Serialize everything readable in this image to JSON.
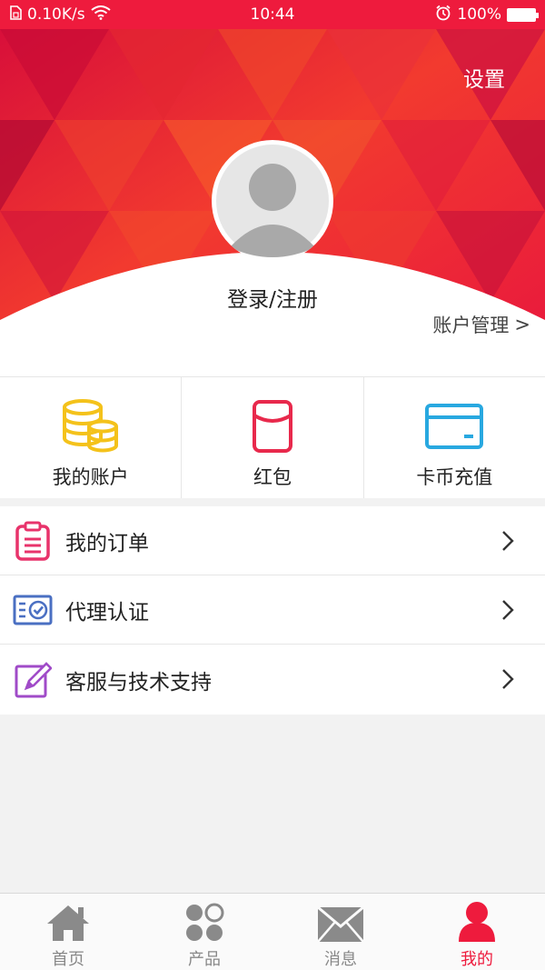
{
  "status_bar": {
    "speed": "0.10K/s",
    "time": "10:44",
    "battery": "100%"
  },
  "header": {
    "settings_label": "设置",
    "login_label": "登录/注册",
    "account_manage_label": "账户管理",
    "account_manage_arrow": ">"
  },
  "shortcuts": [
    {
      "label": "我的账户",
      "icon": "coins-icon",
      "color": "#f4c21b"
    },
    {
      "label": "红包",
      "icon": "red-envelope-icon",
      "color": "#e8294c"
    },
    {
      "label": "卡币充值",
      "icon": "card-icon",
      "color": "#28a8e0"
    }
  ],
  "menu": [
    {
      "label": "我的订单",
      "icon": "clipboard-icon",
      "color": "#e8336b"
    },
    {
      "label": "代理认证",
      "icon": "certificate-icon",
      "color": "#4a6fc2"
    },
    {
      "label": "客服与技术支持",
      "icon": "edit-icon",
      "color": "#a04bc8"
    }
  ],
  "tabbar": [
    {
      "label": "首页",
      "icon": "home-icon",
      "active": false
    },
    {
      "label": "产品",
      "icon": "grid-icon",
      "active": false
    },
    {
      "label": "消息",
      "icon": "envelope-icon",
      "active": false
    },
    {
      "label": "我的",
      "icon": "user-icon",
      "active": true
    }
  ],
  "colors": {
    "brand": "#ee1b3d",
    "inactive_tab": "#888888"
  }
}
